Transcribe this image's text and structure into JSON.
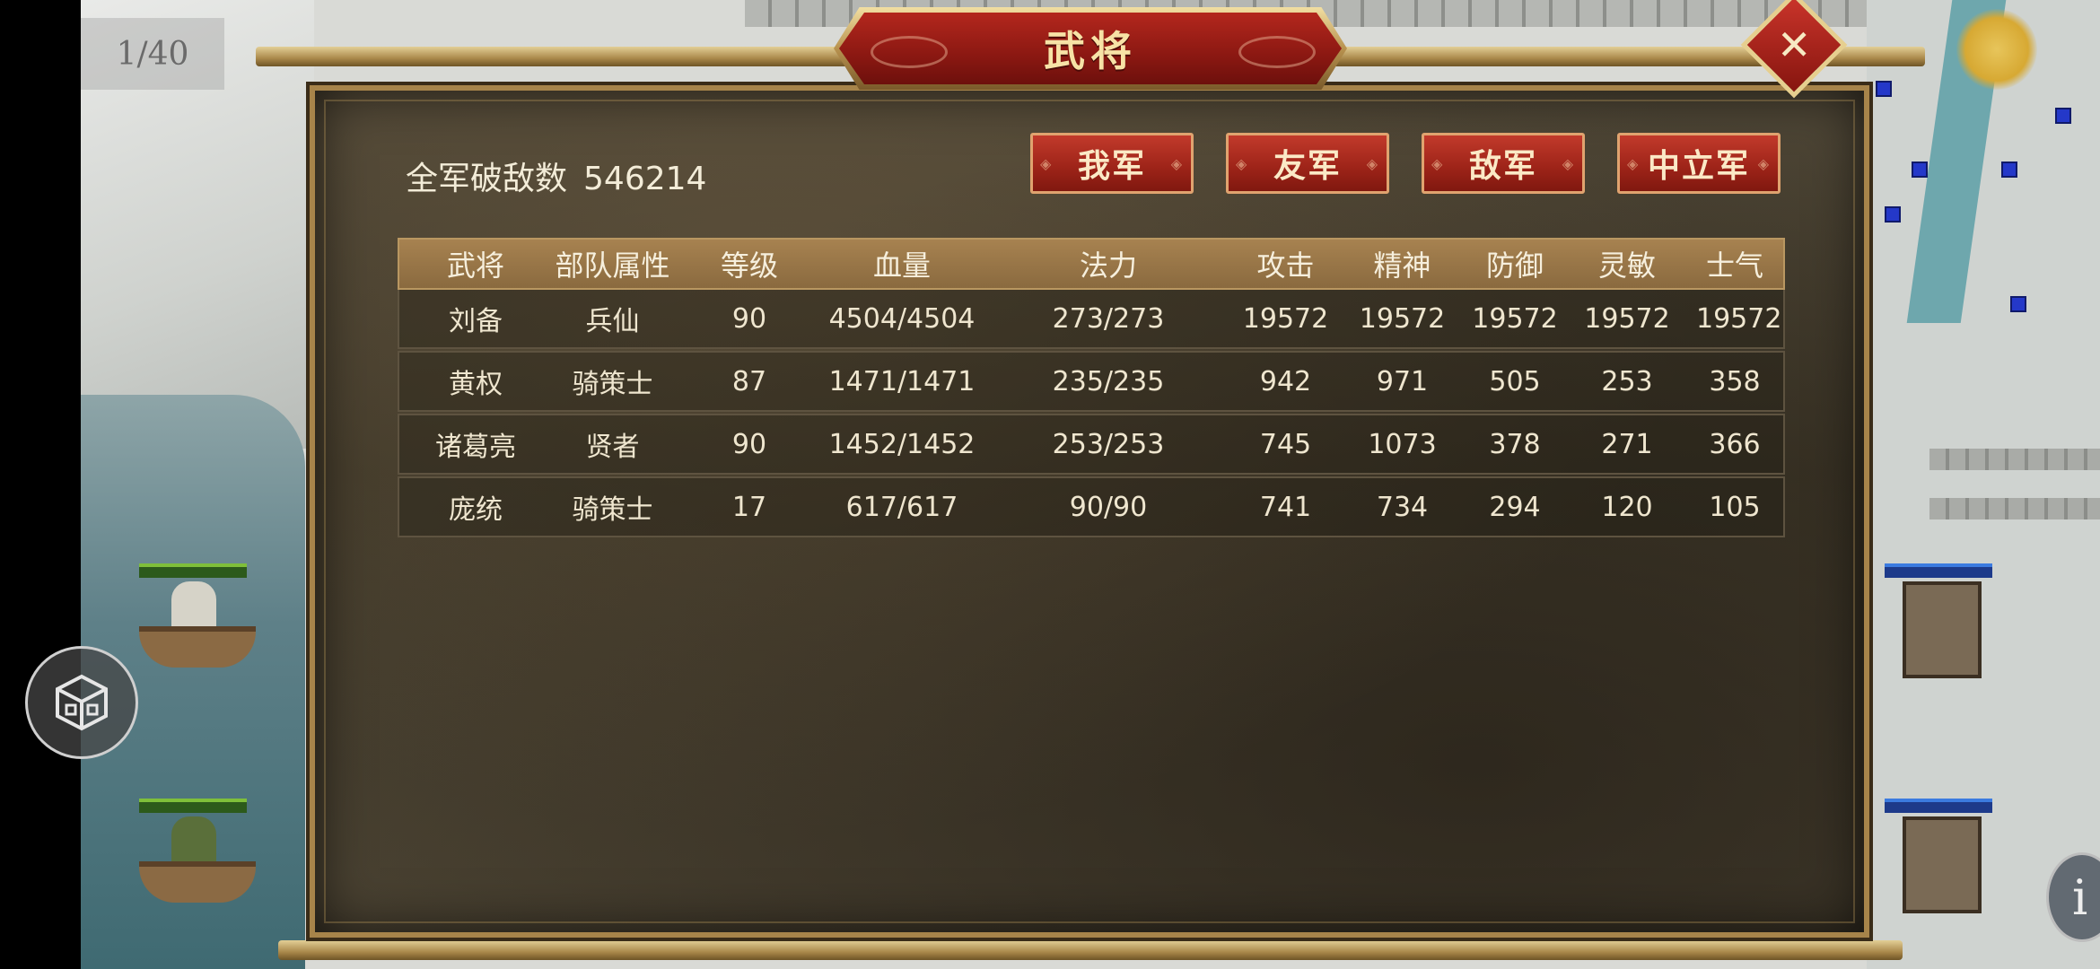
{
  "page_counter": "1/40",
  "dialog": {
    "title": "武将",
    "close_symbol": "✕",
    "total_kills_label": "全军破敌数",
    "total_kills_value": "546214"
  },
  "tabs": [
    {
      "label": "我军"
    },
    {
      "label": "友军"
    },
    {
      "label": "敌军"
    },
    {
      "label": "中立军"
    }
  ],
  "table": {
    "headers": [
      "武将",
      "部队属性",
      "等级",
      "血量",
      "法力",
      "攻击",
      "精神",
      "防御",
      "灵敏",
      "士气"
    ],
    "rows": [
      [
        "刘备",
        "兵仙",
        "90",
        "4504/4504",
        "273/273",
        "19572",
        "19572",
        "19572",
        "19572",
        "19572"
      ],
      [
        "黄权",
        "骑策士",
        "87",
        "1471/1471",
        "235/235",
        "942",
        "971",
        "505",
        "253",
        "358"
      ],
      [
        "诸葛亮",
        "贤者",
        "90",
        "1452/1452",
        "253/253",
        "745",
        "1073",
        "378",
        "271",
        "366"
      ],
      [
        "庞统",
        "骑策士",
        "17",
        "617/617",
        "90/90",
        "741",
        "734",
        "294",
        "120",
        "105"
      ]
    ]
  },
  "info_button_label": "i",
  "icons": {
    "cube": "cube-icon",
    "close": "close-icon",
    "info": "info-icon"
  },
  "colors": {
    "tab_red": "#9c2318",
    "title_red": "#8b1812",
    "frame_gold": "#a7844a",
    "header_bar": "#8a6a3f"
  }
}
